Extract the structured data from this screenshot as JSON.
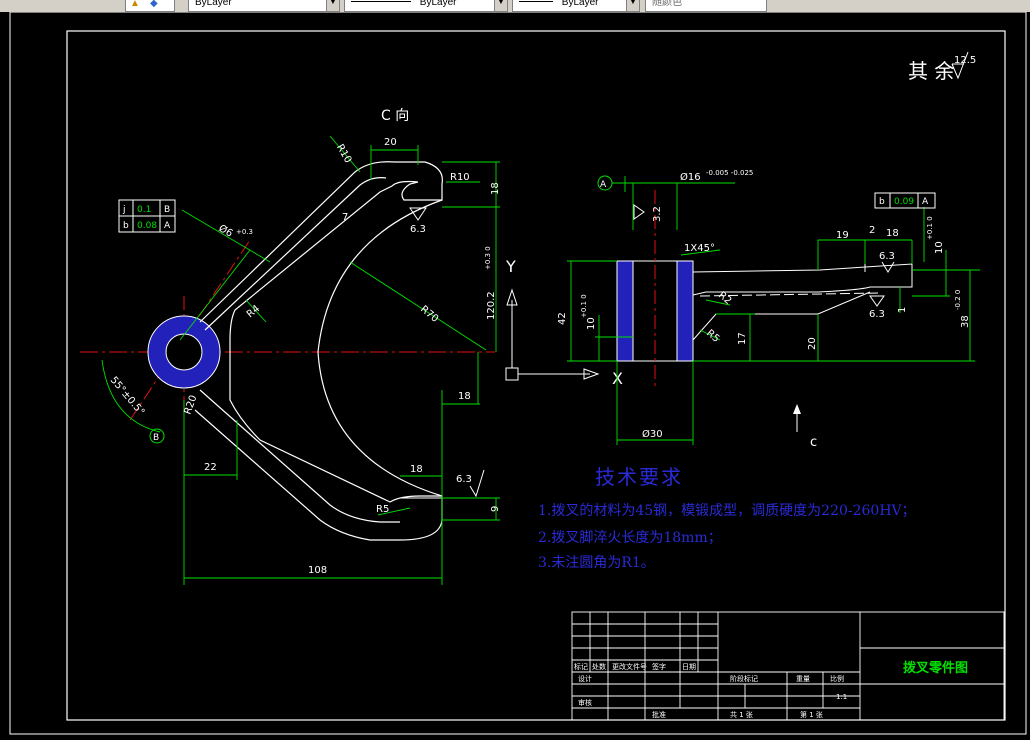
{
  "toolbar": {
    "layer_a": "ByLayer",
    "layer_b": "ByLayer",
    "layer_c": "ByLayer",
    "color": "随颜色"
  },
  "drawing": {
    "view_c_label": "C 向",
    "remaining_finish": "其 余",
    "remaining_finish_value": "12.5",
    "view_c_arrow_label": "c",
    "axis_y": "Y",
    "axis_x": "X",
    "dims": {
      "d20": "20",
      "r10_a": "R10",
      "r10_b": "R10",
      "d18_top": "18",
      "d7": "7",
      "r70": "R70",
      "d120": "120.2",
      "d120_tol": "+0.3 0",
      "phi6": "Ø6",
      "phi6_tol": "+0.3",
      "r4": "R4",
      "angle": "55°±0.5°",
      "r20": "R20",
      "d22": "22",
      "d18_mid": "18",
      "d18_low": "18",
      "d9": "9",
      "r5": "R5",
      "d108": "108",
      "rough_a": "6.3",
      "rough_b": "6.3",
      "phi16": "Ø16",
      "phi16_tol": "-0.005 -0.025",
      "d32": "3.2",
      "chamfer": "1X45°",
      "d42": "42",
      "d10": "10",
      "d10_tol": "+0.1 0",
      "r2": "R2",
      "r5_side": "R5",
      "d17": "17",
      "d20_side": "20",
      "phi30": "Ø30",
      "d19": "19",
      "d2": "2",
      "d18_side": "18",
      "d10_right": "10",
      "d10_right_tol": "+0.1 0",
      "d38": "38",
      "d38_tol": "-0.2 0",
      "d1": "1",
      "rough_c": "6.3",
      "rough_d": "6.3"
    },
    "gdt_left": [
      {
        "sym": "j",
        "val": "0.1",
        "ref": "B"
      },
      {
        "sym": "b",
        "val": "0.08",
        "ref": "A"
      }
    ],
    "gdt_right": {
      "sym": "b",
      "val": "0.09",
      "ref": "A"
    },
    "datum_a": "A",
    "datum_b": "B",
    "tech_title": "技术要求",
    "tech_notes": [
      "1.拨叉的材料为45钢，模锻成型，调质硬度为220-260HV；",
      "2.拨叉脚淬火长度为18mm；",
      "3.未注圆角为R1。"
    ],
    "title_block": {
      "part_name": "拨叉零件图",
      "headers": [
        "标记",
        "处数",
        "更改文件号",
        "签字",
        "日期"
      ],
      "design": "设计",
      "review": "审核",
      "stage_mark": "阶段标记",
      "weight": "重量",
      "scale": "比例",
      "scale_value": "1:1",
      "sheets_total": "共 1 张",
      "sheet_no": "第 1 张",
      "approve": "批准"
    }
  }
}
